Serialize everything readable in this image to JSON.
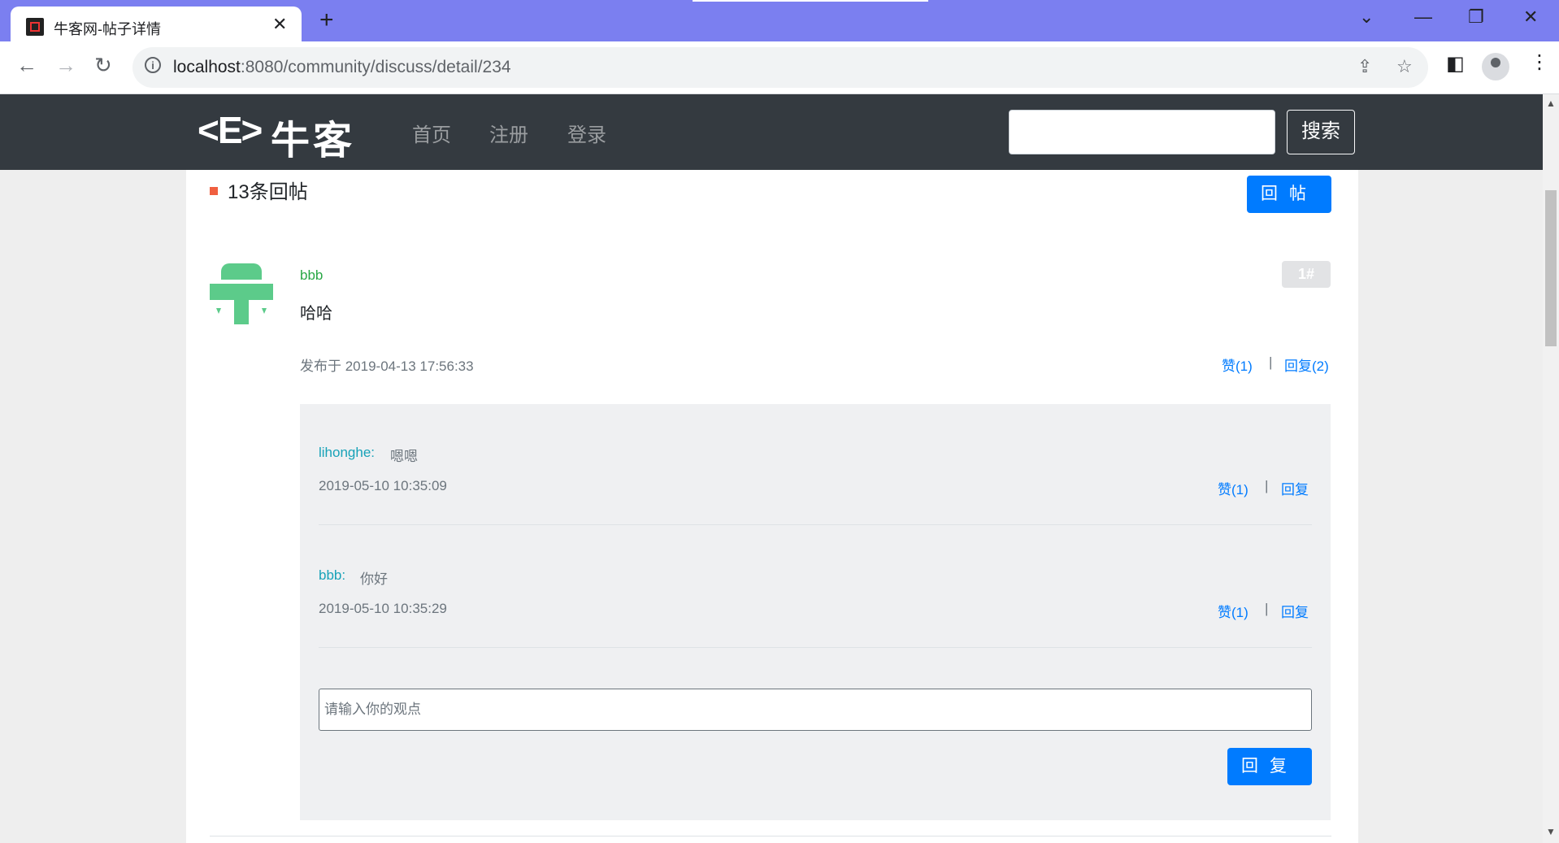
{
  "browser": {
    "tab_title": "牛客网-帖子详情",
    "url_host": "localhost",
    "url_rest": ":8080/community/discuss/detail/234",
    "icons": [
      "back-icon",
      "forward-icon",
      "reload-icon",
      "info-icon",
      "share-icon",
      "star-icon",
      "sidepanel-icon",
      "profile-icon",
      "menu-icon"
    ]
  },
  "header": {
    "logo_mark": "<E>",
    "logo_text": "牛客",
    "nav": [
      "首页",
      "注册",
      "登录"
    ],
    "search_placeholder": "",
    "search_button": "搜索"
  },
  "replies_section": {
    "title": "13条回帖",
    "reply_button": "回帖"
  },
  "reply": {
    "username": "bbb",
    "floor": "1#",
    "content": "哈哈",
    "posted_at": "发布于 2019-04-13 17:56:33",
    "like_label": "赞(1)",
    "separator": "|",
    "reply_label": "回复(2)",
    "comments": [
      {
        "user": "lihonghe:",
        "text": "嗯嗯",
        "time": "2019-05-10 10:35:09",
        "like_label": "赞(1)",
        "reply_label": "回复"
      },
      {
        "user": "bbb:",
        "text": "你好",
        "time": "2019-05-10 10:35:29",
        "like_label": "赞(1)",
        "reply_label": "回复"
      }
    ],
    "comment_placeholder": "请输入你的观点",
    "comment_submit": "回复"
  },
  "colors": {
    "header_bg": "#343a40",
    "primary": "#007bff",
    "username_green": "#28a745",
    "comment_user": "#17a2b8",
    "tabbar": "#7b7ff0"
  }
}
